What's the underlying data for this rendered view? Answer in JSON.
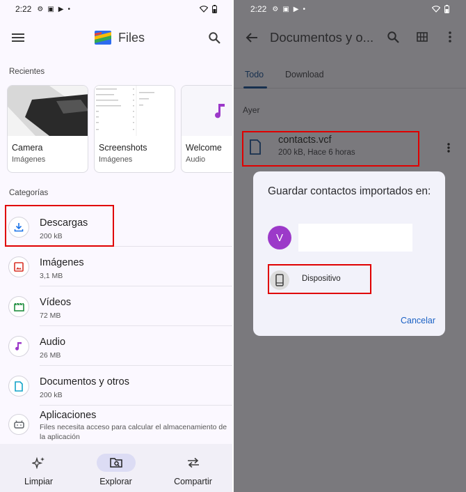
{
  "left": {
    "status": {
      "time": "2:22"
    },
    "appbar": {
      "title": "Files"
    },
    "recents": {
      "label": "Recientes",
      "cards": [
        {
          "title": "Camera",
          "subtitle": "Imágenes"
        },
        {
          "title": "Screenshots",
          "subtitle": "Imágenes"
        },
        {
          "title": "Welcome",
          "subtitle": "Audio"
        }
      ]
    },
    "categories": {
      "label": "Categorías",
      "items": [
        {
          "title": "Descargas",
          "subtitle": "200 kB"
        },
        {
          "title": "Imágenes",
          "subtitle": "3,1 MB"
        },
        {
          "title": "Vídeos",
          "subtitle": "72 MB"
        },
        {
          "title": "Audio",
          "subtitle": "26 MB"
        },
        {
          "title": "Documentos y otros",
          "subtitle": "200 kB"
        },
        {
          "title": "Aplicaciones",
          "subtitle": "Files necesita acceso para calcular el almacenamiento de la aplicación"
        }
      ]
    },
    "bottom_nav": [
      {
        "label": "Limpiar"
      },
      {
        "label": "Explorar"
      },
      {
        "label": "Compartir"
      }
    ]
  },
  "right": {
    "status": {
      "time": "2:22"
    },
    "appbar": {
      "title": "Documentos y o..."
    },
    "tabs": [
      {
        "label": "Todo"
      },
      {
        "label": "Download"
      }
    ],
    "day_label": "Ayer",
    "file": {
      "name": "contacts.vcf",
      "meta": "200 kB, Hace 6 horas"
    },
    "dialog": {
      "title": "Guardar contactos importados en:",
      "avatar_letter": "V",
      "option_label": "Dispositivo",
      "cancel_label": "Cancelar"
    }
  },
  "colors": {
    "highlight": "#e00000",
    "accent_blue": "#1a61c4",
    "avatar_purple": "#9c39c9",
    "overlay_bg": "#7a797d"
  }
}
